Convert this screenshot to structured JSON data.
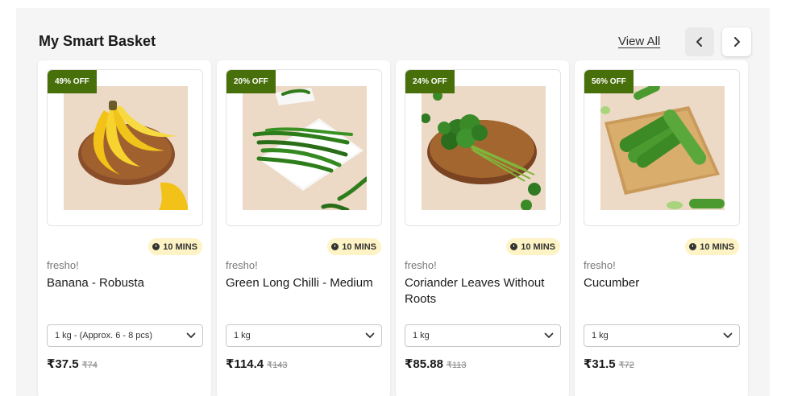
{
  "section": {
    "title": "My Smart Basket",
    "view_all": "View All",
    "prev_icon": "chevron-left-icon",
    "next_icon": "chevron-right-icon"
  },
  "colors": {
    "badge": "#476f0a",
    "eta_bg": "#fdf3c4"
  },
  "products": [
    {
      "discount": "49% OFF",
      "eta": "10 MINS",
      "brand": "fresho!",
      "name": "Banana - Robusta",
      "pack": "1 kg - (Approx. 6 - 8 pcs)",
      "price": "₹37.5",
      "mrp": "₹74",
      "image": "banana-image"
    },
    {
      "discount": "20% OFF",
      "eta": "10 MINS",
      "brand": "fresho!",
      "name": "Green Long Chilli - Medium",
      "pack": "1 kg",
      "price": "₹114.4",
      "mrp": "₹143",
      "image": "chilli-image"
    },
    {
      "discount": "24% OFF",
      "eta": "10 MINS",
      "brand": "fresho!",
      "name": "Coriander Leaves Without Roots",
      "pack": "1 kg",
      "price": "₹85.88",
      "mrp": "₹113",
      "image": "coriander-image"
    },
    {
      "discount": "56% OFF",
      "eta": "10 MINS",
      "brand": "fresho!",
      "name": "Cucumber",
      "pack": "1 kg",
      "price": "₹31.5",
      "mrp": "₹72",
      "image": "cucumber-image"
    }
  ]
}
